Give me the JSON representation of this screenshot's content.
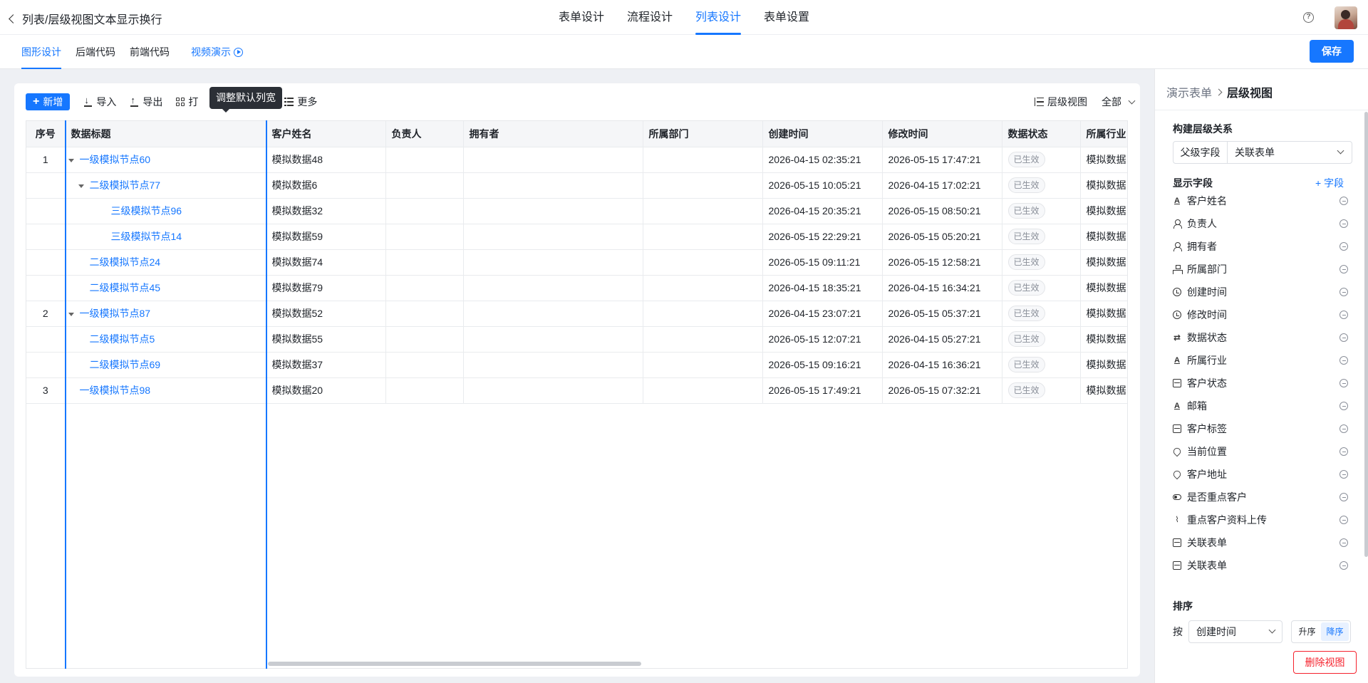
{
  "header": {
    "title": "列表/层级视图文本显示换行",
    "tabs": [
      {
        "label": "表单设计"
      },
      {
        "label": "流程设计"
      },
      {
        "label": "列表设计"
      },
      {
        "label": "表单设置"
      }
    ],
    "help": "?"
  },
  "subheader": {
    "tabs": [
      {
        "label": "图形设计"
      },
      {
        "label": "后端代码"
      },
      {
        "label": "前端代码"
      }
    ],
    "video_link": "视频演示",
    "save_label": "保存"
  },
  "toolbar": {
    "add_label": "新增",
    "import_label": "导入",
    "export_label": "导出",
    "print_label": "打",
    "delete_label": "删除",
    "more_label": "更多",
    "tooltip": "调整默认列宽",
    "view_label": "层级视图",
    "filter_label": "全部"
  },
  "table": {
    "headers": [
      "序号",
      "数据标题",
      "客户姓名",
      "负责人",
      "拥有者",
      "所属部门",
      "创建时间",
      "修改时间",
      "数据状态",
      "所属行业"
    ],
    "rows": [
      {
        "seq": "1",
        "level": 1,
        "expand": true,
        "title": "一级模拟节点60",
        "customer": "模拟数据48",
        "owner": "",
        "holder": "",
        "dept": "",
        "created": "2026-04-15 02:35:21",
        "modified": "2026-05-15 17:47:21",
        "status": "已生效",
        "industry": "模拟数据"
      },
      {
        "seq": "",
        "level": 2,
        "expand": true,
        "title": "二级模拟节点77",
        "customer": "模拟数据6",
        "owner": "",
        "holder": "",
        "dept": "",
        "created": "2026-05-15 10:05:21",
        "modified": "2026-04-15 17:02:21",
        "status": "已生效",
        "industry": "模拟数据"
      },
      {
        "seq": "",
        "level": 3,
        "expand": false,
        "title": "三级模拟节点96",
        "customer": "模拟数据32",
        "owner": "",
        "holder": "",
        "dept": "",
        "created": "2026-04-15 20:35:21",
        "modified": "2026-05-15 08:50:21",
        "status": "已生效",
        "industry": "模拟数据"
      },
      {
        "seq": "",
        "level": 3,
        "expand": false,
        "title": "三级模拟节点14",
        "customer": "模拟数据59",
        "owner": "",
        "holder": "",
        "dept": "",
        "created": "2026-05-15 22:29:21",
        "modified": "2026-05-15 05:20:21",
        "status": "已生效",
        "industry": "模拟数据"
      },
      {
        "seq": "",
        "level": 2,
        "expand": false,
        "title": "二级模拟节点24",
        "customer": "模拟数据74",
        "owner": "",
        "holder": "",
        "dept": "",
        "created": "2026-05-15 09:11:21",
        "modified": "2026-05-15 12:58:21",
        "status": "已生效",
        "industry": "模拟数据"
      },
      {
        "seq": "",
        "level": 2,
        "expand": false,
        "title": "二级模拟节点45",
        "customer": "模拟数据79",
        "owner": "",
        "holder": "",
        "dept": "",
        "created": "2026-04-15 18:35:21",
        "modified": "2026-04-15 16:34:21",
        "status": "已生效",
        "industry": "模拟数据"
      },
      {
        "seq": "2",
        "level": 1,
        "expand": true,
        "title": "一级模拟节点87",
        "customer": "模拟数据52",
        "owner": "",
        "holder": "",
        "dept": "",
        "created": "2026-04-15 23:07:21",
        "modified": "2026-05-15 05:37:21",
        "status": "已生效",
        "industry": "模拟数据"
      },
      {
        "seq": "",
        "level": 2,
        "expand": false,
        "title": "二级模拟节点5",
        "customer": "模拟数据55",
        "owner": "",
        "holder": "",
        "dept": "",
        "created": "2026-05-15 12:07:21",
        "modified": "2026-04-15 05:27:21",
        "status": "已生效",
        "industry": "模拟数据"
      },
      {
        "seq": "",
        "level": 2,
        "expand": false,
        "title": "二级模拟节点69",
        "customer": "模拟数据37",
        "owner": "",
        "holder": "",
        "dept": "",
        "created": "2026-05-15 09:16:21",
        "modified": "2026-04-15 16:36:21",
        "status": "已生效",
        "industry": "模拟数据"
      },
      {
        "seq": "3",
        "level": 1,
        "expand": false,
        "title": "一级模拟节点98",
        "customer": "模拟数据20",
        "owner": "",
        "holder": "",
        "dept": "",
        "created": "2026-05-15 17:49:21",
        "modified": "2026-05-15 07:32:21",
        "status": "已生效",
        "industry": "模拟数据"
      }
    ]
  },
  "panel": {
    "breadcrumb_parent": "演示表单",
    "breadcrumb_current": "层级视图",
    "hierarchy_title": "构建层级关系",
    "parent_field_label": "父级字段",
    "parent_field_value": "关联表单",
    "display_title": "显示字段",
    "add_field_label": "字段",
    "fields": [
      {
        "label": "客户姓名",
        "icon": "text-icon"
      },
      {
        "label": "负责人",
        "icon": "user-icon"
      },
      {
        "label": "拥有者",
        "icon": "user-icon"
      },
      {
        "label": "所属部门",
        "icon": "dept-icon"
      },
      {
        "label": "创建时间",
        "icon": "clock-icon"
      },
      {
        "label": "修改时间",
        "icon": "clock-icon"
      },
      {
        "label": "数据状态",
        "icon": "sync-icon"
      },
      {
        "label": "所属行业",
        "icon": "text-icon"
      },
      {
        "label": "客户状态",
        "icon": "box-icon"
      },
      {
        "label": "邮箱",
        "icon": "text-icon"
      },
      {
        "label": "客户标签",
        "icon": "box-icon"
      },
      {
        "label": "当前位置",
        "icon": "pin-icon"
      },
      {
        "label": "客户地址",
        "icon": "pin-icon"
      },
      {
        "label": "是否重点客户",
        "icon": "toggle-icon"
      },
      {
        "label": "重点客户资料上传",
        "icon": "attach-icon"
      },
      {
        "label": "关联表单",
        "icon": "form-icon"
      },
      {
        "label": "关联表单",
        "icon": "form-icon"
      }
    ],
    "sort_title": "排序",
    "sort_by_label": "按",
    "sort_field": "创建时间",
    "sort_asc": "升序",
    "sort_desc": "降序",
    "delete_view_label": "删除视图"
  }
}
